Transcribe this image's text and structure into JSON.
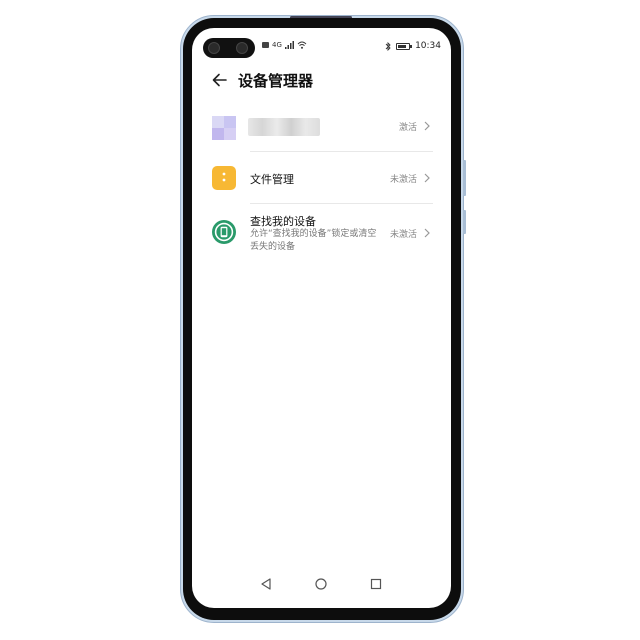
{
  "status_bar": {
    "time": "10:34",
    "network_label": "4G"
  },
  "header": {
    "title": "设备管理器"
  },
  "items": [
    {
      "title": "",
      "status": "激活"
    },
    {
      "title": "文件管理",
      "status": "未激活"
    },
    {
      "title": "查找我的设备",
      "subtitle": "允许“查找我的设备”锁定或清空丢失的设备",
      "status": "未激活"
    }
  ],
  "colors": {
    "file_icon": "#f7b834",
    "find_icon": "#2a9a6a",
    "blurred_icon": "#c5c3f0"
  },
  "icons": [
    "back-arrow-icon",
    "folder-icon",
    "find-device-icon",
    "chevron-right-icon",
    "nav-back-icon",
    "nav-home-icon",
    "nav-recents-icon"
  ]
}
